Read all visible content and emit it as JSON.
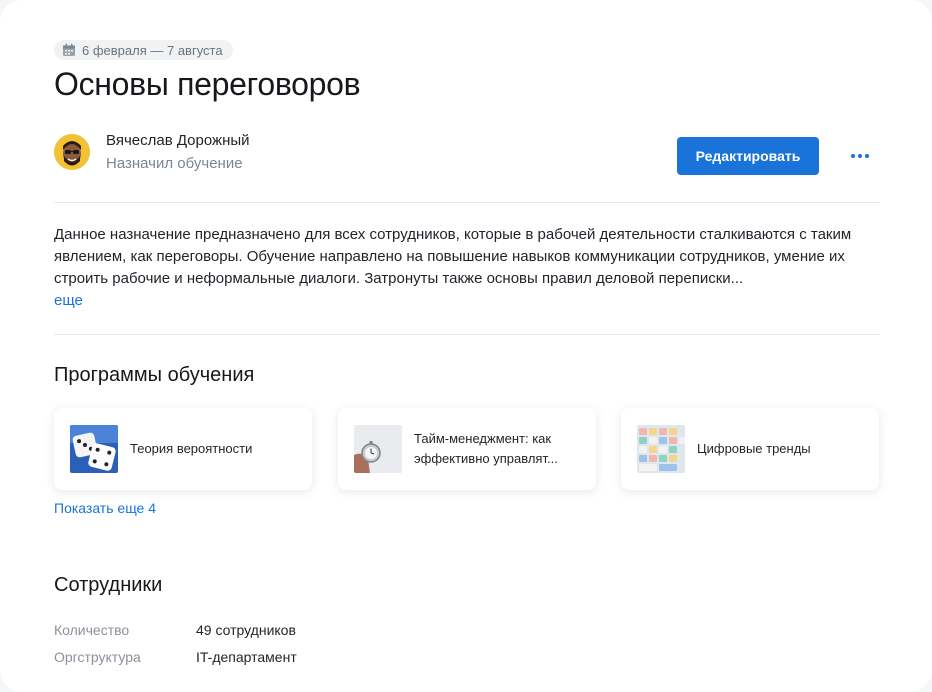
{
  "header": {
    "date_range": "6 февраля — 7 августа",
    "title": "Основы переговоров"
  },
  "author": {
    "name": "Вячеслав Дорожный",
    "role": "Назначил обучение"
  },
  "actions": {
    "edit_label": "Редактировать"
  },
  "description": {
    "text": "Данное назначение предназначено для всех сотрудников, которые в рабочей деятельности сталкиваются с таким явлением, как переговоры. Обучение направлено на повышение навыков коммуникации сотрудников, умение их строить рабочие и неформальные диалоги. Затронуты также основы правил деловой переписки...",
    "more_label": "еще"
  },
  "programs": {
    "title": "Программы обучения",
    "items": [
      {
        "label": "Теория вероятности",
        "icon": "dice-image"
      },
      {
        "label": "Тайм-менеджмент: как эффективно управлят...",
        "icon": "stopwatch-image"
      },
      {
        "label": "Цифровые тренды",
        "icon": "keyboard-image"
      }
    ],
    "show_more_label": "Показать еще 4"
  },
  "employees": {
    "title": "Сотрудники",
    "rows": [
      {
        "label": "Количество",
        "value": "49 сотрудников"
      },
      {
        "label": "Оргструктура",
        "value": "IT-департамент"
      }
    ]
  },
  "colors": {
    "accent": "#1a73d9",
    "muted_text": "#7c8591"
  }
}
